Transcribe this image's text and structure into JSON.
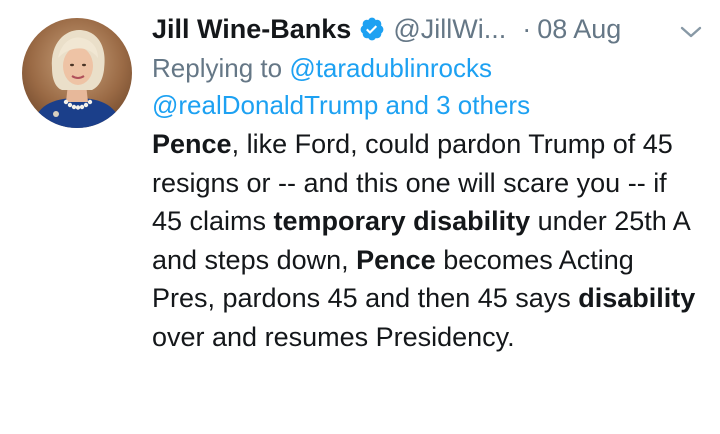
{
  "tweet": {
    "author_name": "Jill Wine-Banks",
    "handle": "@JillWi...",
    "separator": "·",
    "date": "08 Aug",
    "replying_prefix": "Replying to",
    "reply_mention_1": "@taradublinrocks",
    "reply_mention_2": "@realDonaldTrump and 3 others",
    "body_segments": [
      {
        "text": "Pence",
        "bold": true
      },
      {
        "text": ", like Ford, could pardon Trump of 45 resigns or -- and this one will scare you -- if 45 claims ",
        "bold": false
      },
      {
        "text": "temporary disability",
        "bold": true
      },
      {
        "text": " under 25th A and steps down, ",
        "bold": false
      },
      {
        "text": "Pence",
        "bold": true
      },
      {
        "text": " becomes Acting Pres, pardons 45 and then 45 says ",
        "bold": false
      },
      {
        "text": "disability",
        "bold": true
      },
      {
        "text": " over and resumes Presidency.",
        "bold": false
      }
    ]
  },
  "icons": {
    "verified": "verified-badge-icon",
    "caret": "chevron-down-icon"
  },
  "colors": {
    "text": "#14171a",
    "muted": "#657786",
    "link": "#1da1f2",
    "verified": "#1da1f2"
  }
}
